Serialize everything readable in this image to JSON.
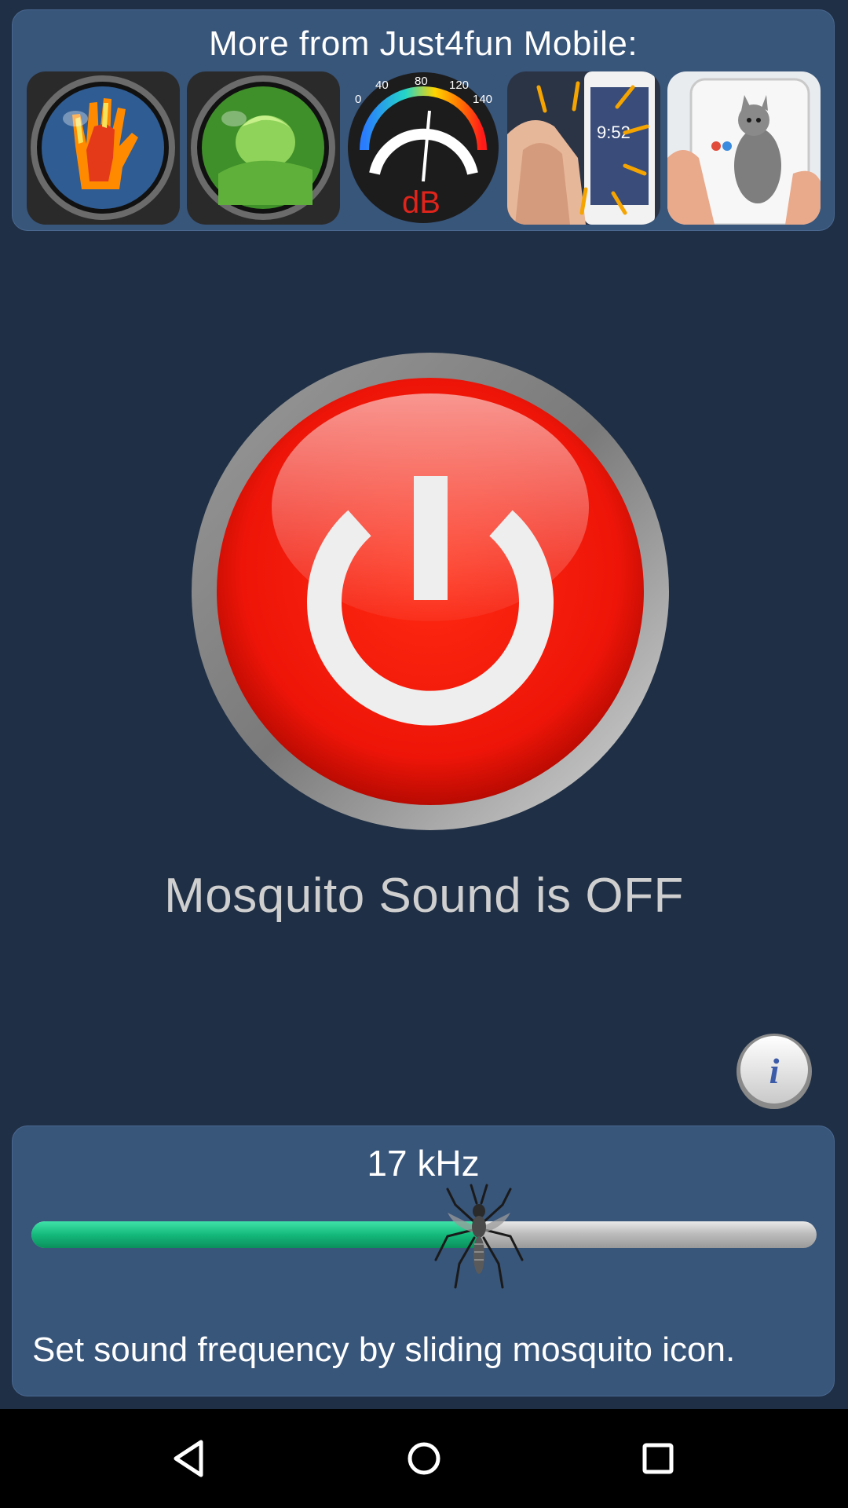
{
  "promo": {
    "title": "More from Just4fun Mobile:",
    "apps": [
      {
        "icon": "thermal-hand-icon"
      },
      {
        "icon": "night-vision-icon"
      },
      {
        "icon": "sound-meter-icon",
        "gauge_labels": [
          "0",
          "40",
          "80",
          "120",
          "140"
        ],
        "unit": "dB"
      },
      {
        "icon": "clap-phone-icon"
      },
      {
        "icon": "cat-phone-icon"
      }
    ]
  },
  "power": {
    "status_text": "Mosquito Sound is OFF",
    "state": "off",
    "color": "#e8140a"
  },
  "frequency": {
    "value_label": "17 kHz",
    "slider_fraction": 0.57,
    "fill_color": "#14b97b",
    "hint": "Set sound frequency by sliding mosquito icon."
  },
  "info": {
    "icon": "info-icon"
  },
  "nav": {
    "back": "back-icon",
    "home": "home-icon",
    "recents": "recents-icon"
  }
}
